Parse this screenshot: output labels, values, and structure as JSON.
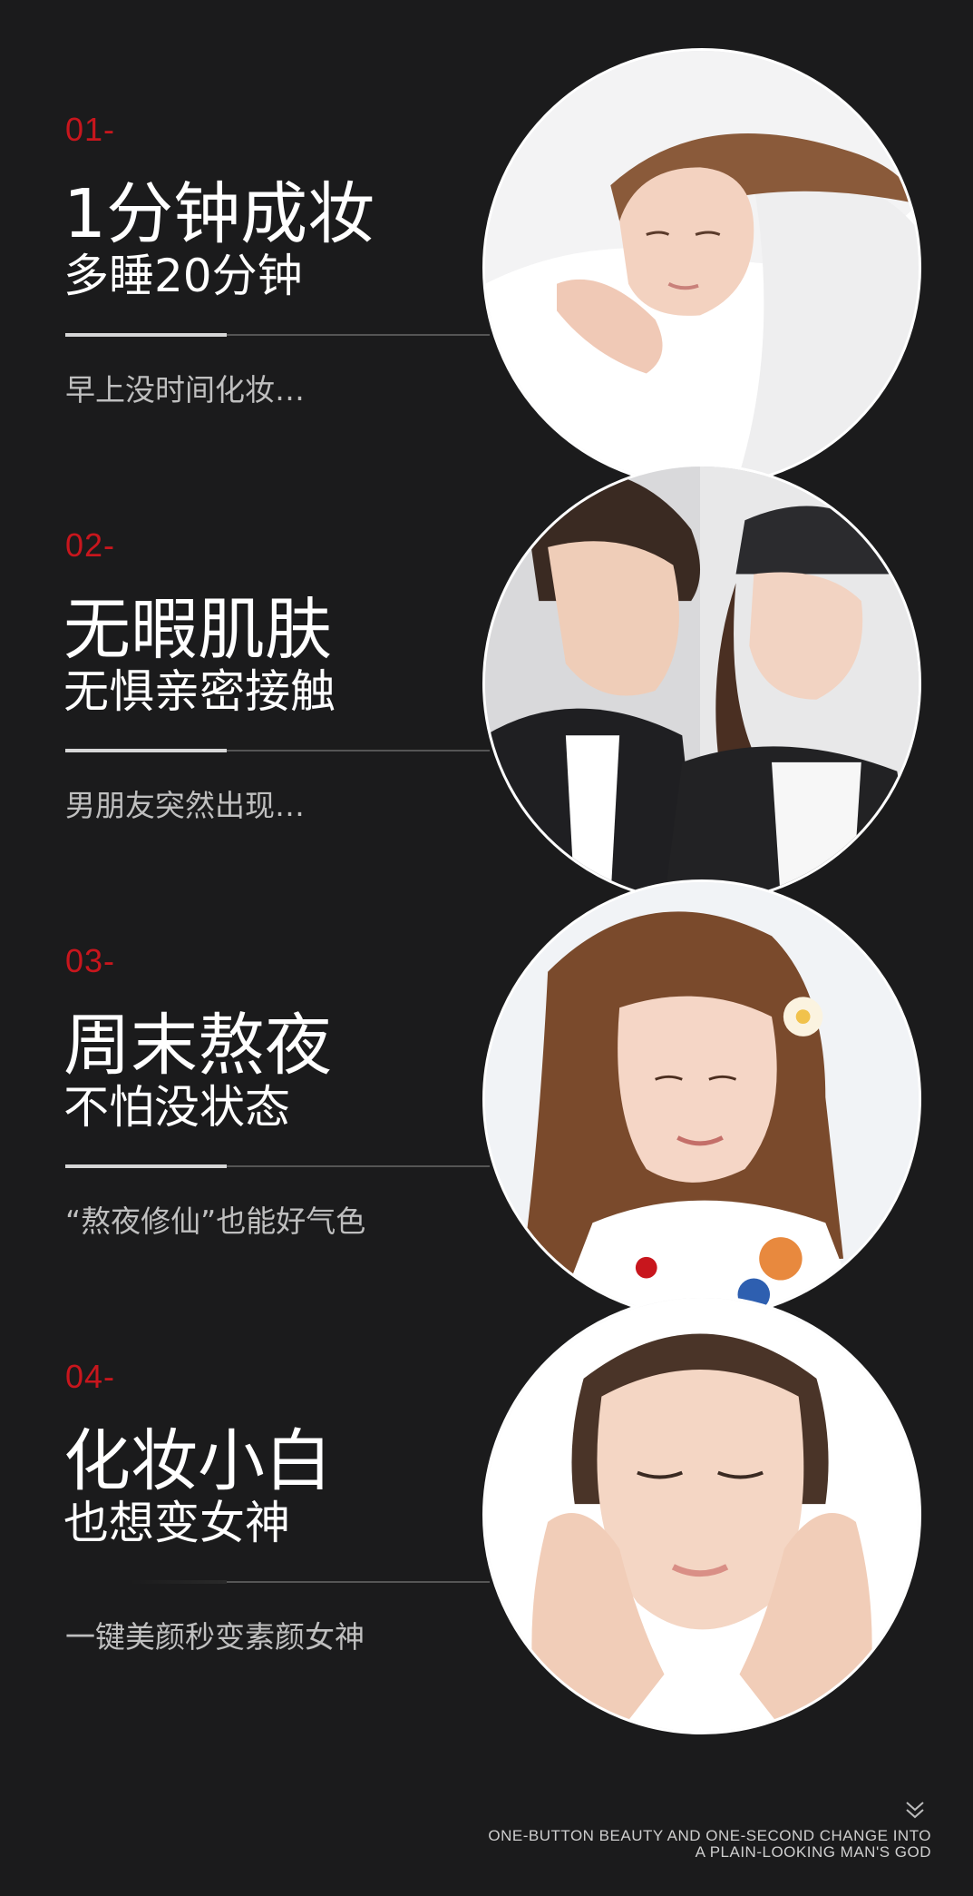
{
  "sections": [
    {
      "number": "01-",
      "title": "1分钟成妆",
      "subtitle": "多睡20分钟",
      "description": "早上没时间化妆…",
      "image": "woman-sleeping-on-pillow"
    },
    {
      "number": "02-",
      "title": "无暇肌肤",
      "subtitle": "无惧亲密接触",
      "description": "男朋友突然出现…",
      "image": "couple-close-up"
    },
    {
      "number": "03-",
      "title": "周末熬夜",
      "subtitle": "不怕没状态",
      "description": "“熬夜修仙”也能好气色",
      "image": "smiling-woman-with-flower"
    },
    {
      "number": "04-",
      "title": "化妆小白",
      "subtitle": "也想变女神",
      "description": "一键美颜秒变素颜女神",
      "image": "woman-hands-on-face"
    }
  ],
  "footer": {
    "line1": "ONE-BUTTON BEAUTY AND ONE-SECOND CHANGE INTO",
    "line2": "A PLAIN-LOOKING MAN'S GOD",
    "icon": "double-chevron-down-icon"
  },
  "colors": {
    "background": "#1b1b1c",
    "accent": "#c8161d",
    "text": "#ffffff",
    "muted": "#bfbfbf"
  }
}
